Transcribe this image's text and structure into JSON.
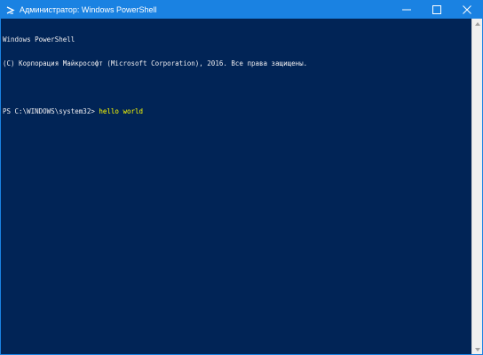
{
  "window": {
    "title": "Администратор: Windows PowerShell",
    "accent_color": "#1a82e2",
    "console_bg": "#012456",
    "app_icon": "powershell-icon",
    "controls": [
      "minimize-icon",
      "maximize-icon",
      "close-icon"
    ]
  },
  "console": {
    "header_line1": "Windows PowerShell",
    "header_line2": "(C) Корпорация Майкрософт (Microsoft Corporation), 2016. Все права защищены.",
    "prompt": "PS C:\\WINDOWS\\system32> ",
    "command": "hello world",
    "command_color": "#ffff00"
  }
}
